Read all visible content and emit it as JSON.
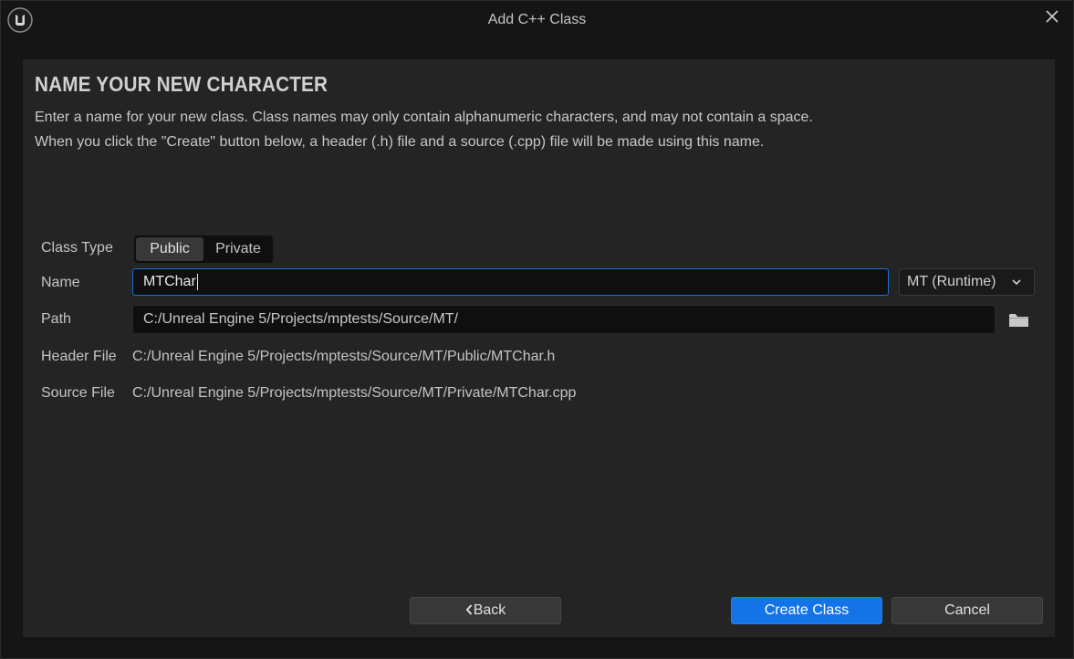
{
  "window": {
    "title": "Add C++ Class"
  },
  "header": {
    "heading": "NAME YOUR NEW CHARACTER",
    "description_line1": "Enter a name for your new class. Class names may only contain alphanumeric characters, and may not contain a space.",
    "description_line2": "When you click the \"Create\" button below, a header (.h) file and a source (.cpp) file will be made using this name."
  },
  "form": {
    "class_type_label": "Class Type",
    "class_type_options": [
      "Public",
      "Private"
    ],
    "class_type_selected": "Public",
    "name_label": "Name",
    "name_value": "MTChar",
    "module_selected": "MT (Runtime)",
    "path_label": "Path",
    "path_value": "C:/Unreal Engine 5/Projects/mptests/Source/MT/",
    "header_file_label": "Header File",
    "header_file_value": "C:/Unreal Engine 5/Projects/mptests/Source/MT/Public/MTChar.h",
    "source_file_label": "Source File",
    "source_file_value": "C:/Unreal Engine 5/Projects/mptests/Source/MT/Private/MTChar.cpp"
  },
  "footer": {
    "back_label": "Back",
    "create_label": "Create Class",
    "cancel_label": "Cancel"
  },
  "icons": {
    "app_logo": "unreal-logo-icon",
    "close": "close-icon",
    "dropdown": "chevron-down-icon",
    "folder": "folder-icon",
    "back": "chevron-left-icon"
  },
  "colors": {
    "accent": "#1473e6",
    "panel_bg": "#242424",
    "window_bg": "#151515"
  }
}
